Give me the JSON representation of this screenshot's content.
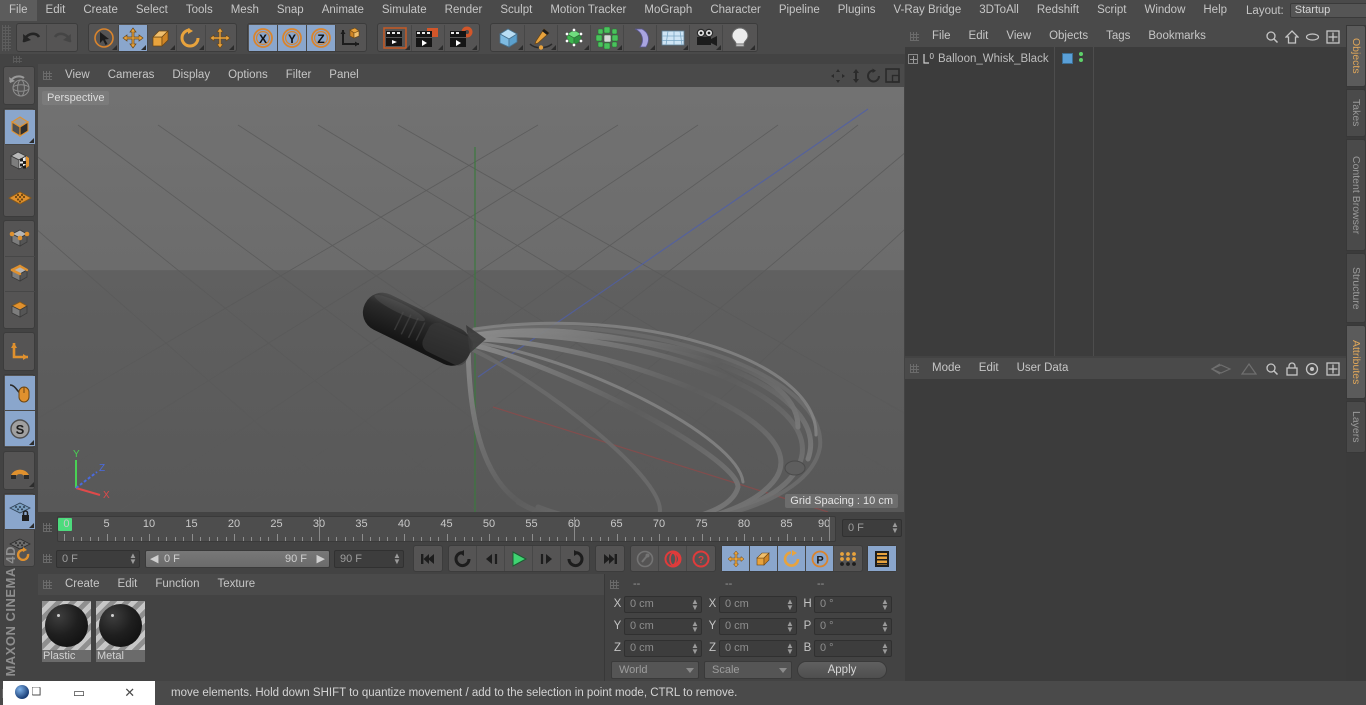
{
  "menubar": {
    "items": [
      "File",
      "Edit",
      "Create",
      "Select",
      "Tools",
      "Mesh",
      "Snap",
      "Animate",
      "Simulate",
      "Render",
      "Sculpt",
      "Motion Tracker",
      "MoGraph",
      "Character",
      "Pipeline",
      "Plugins",
      "V-Ray Bridge",
      "3DToAll",
      "Redshift",
      "Script",
      "Window",
      "Help"
    ],
    "layout_label": "Layout:",
    "layout_value": "Startup",
    "search_icon": "search-icon"
  },
  "toolbar": {
    "groups": [
      {
        "name": "undo-redo",
        "buttons": [
          {
            "icon": "undo-icon",
            "active": false
          },
          {
            "icon": "redo-icon",
            "active": false
          }
        ]
      },
      {
        "name": "transform-tools",
        "buttons": [
          {
            "icon": "live-selection-icon",
            "active": false
          },
          {
            "icon": "move-icon",
            "active": true
          },
          {
            "icon": "scale-icon",
            "active": false
          },
          {
            "icon": "rotate-icon",
            "active": false
          },
          {
            "icon": "move-dynamic-icon",
            "active": false
          }
        ]
      },
      {
        "name": "axis-locks",
        "buttons": [
          {
            "icon": "x-axis-icon",
            "active": true
          },
          {
            "icon": "y-axis-icon",
            "active": true
          },
          {
            "icon": "z-axis-icon",
            "active": true
          },
          {
            "icon": "world-object-axis-icon",
            "active": false
          }
        ]
      },
      {
        "name": "render-tools",
        "buttons": [
          {
            "icon": "render-view-icon",
            "active": false
          },
          {
            "icon": "render-region-icon",
            "active": false
          },
          {
            "icon": "render-settings-icon",
            "active": false
          }
        ]
      },
      {
        "name": "create-objects",
        "buttons": [
          {
            "icon": "cube-primitive-icon",
            "active": false
          },
          {
            "icon": "spline-pen-icon",
            "active": false
          },
          {
            "icon": "nurbs-generator-icon",
            "active": false
          },
          {
            "icon": "array-modeling-icon",
            "active": false
          },
          {
            "icon": "deformer-bend-icon",
            "active": false
          },
          {
            "icon": "floor-environment-icon",
            "active": false
          },
          {
            "icon": "camera-icon",
            "active": false
          },
          {
            "icon": "light-icon",
            "active": false
          }
        ]
      }
    ]
  },
  "left_toolbar": {
    "groups": [
      {
        "buttons": [
          {
            "icon": "undo-view-globe-icon",
            "active": false
          }
        ]
      },
      {
        "buttons": [
          {
            "icon": "model-mode-icon",
            "active": true
          },
          {
            "icon": "texture-mode-icon",
            "active": false
          },
          {
            "icon": "workplane-mode-icon",
            "active": false
          }
        ]
      },
      {
        "buttons": [
          {
            "icon": "point-mode-icon",
            "active": false
          },
          {
            "icon": "edge-mode-icon",
            "active": false
          },
          {
            "icon": "polygon-mode-icon",
            "active": false
          }
        ]
      },
      {
        "buttons": [
          {
            "icon": "axis-modify-icon",
            "active": false
          }
        ]
      },
      {
        "buttons": [
          {
            "icon": "enable-axis-mouse-icon",
            "active": true
          },
          {
            "icon": "snap-mode-icon",
            "active": true
          }
        ]
      },
      {
        "buttons": [
          {
            "icon": "magnet-tool-icon",
            "active": false
          }
        ]
      },
      {
        "buttons": [
          {
            "icon": "workplane-lock-icon",
            "active": true
          },
          {
            "icon": "workplane-rotate-icon",
            "active": false
          }
        ]
      }
    ],
    "brand": "MAXON CINEMA 4D"
  },
  "viewport": {
    "menu": [
      "View",
      "Cameras",
      "Display",
      "Options",
      "Filter",
      "Panel"
    ],
    "icons": [
      "pan-view-icon",
      "dolly-view-icon",
      "rotate-view-icon",
      "maximize-view-icon"
    ],
    "label": "Perspective",
    "grid_spacing": "Grid Spacing : 10 cm",
    "axis": {
      "x": "X",
      "y": "Y",
      "z": "Z",
      "x_color": "#e04a4a",
      "y_color": "#49d154",
      "z_color": "#4a6ae0"
    },
    "object": "Balloon_Whisk_Black 3D model"
  },
  "timeline": {
    "ruler_min": 0,
    "ruler_max": 90,
    "tick_labels": [
      0,
      5,
      10,
      15,
      20,
      25,
      30,
      35,
      40,
      45,
      50,
      55,
      60,
      65,
      70,
      75,
      80,
      85,
      90
    ],
    "current_frame_field": "0 F",
    "start_frame_field": "0 F",
    "range_start": "0 F",
    "range_end": "90 F",
    "end_frame_field": "90 F",
    "playback_buttons": [
      {
        "icon": "go-to-start-icon",
        "active": false
      },
      {
        "icon": "play-backward-loop-icon",
        "active": false
      },
      {
        "icon": "step-back-icon",
        "active": false
      },
      {
        "icon": "play-forward-icon",
        "active": false
      },
      {
        "icon": "step-forward-icon",
        "active": false
      },
      {
        "icon": "loop-playback-icon",
        "active": false
      },
      {
        "icon": "go-to-end-icon",
        "active": false
      }
    ],
    "key_buttons": [
      {
        "icon": "record-key-icon",
        "active": false
      },
      {
        "icon": "autokey-icon",
        "active": false
      },
      {
        "icon": "keyframe-selection-icon",
        "active": false
      }
    ],
    "param_buttons": [
      {
        "icon": "key-position-icon",
        "active": true
      },
      {
        "icon": "key-scale-icon",
        "active": true
      },
      {
        "icon": "key-rotation-icon",
        "active": true
      },
      {
        "icon": "key-param-icon",
        "active": true
      },
      {
        "icon": "point-level-animation-icon",
        "active": false
      },
      {
        "icon": "timeline-ruler-icon",
        "active": true
      }
    ]
  },
  "material_manager": {
    "menu": [
      "Create",
      "Edit",
      "Function",
      "Texture"
    ],
    "materials": [
      {
        "name": "Plastic",
        "selected": true
      },
      {
        "name": "Metal",
        "selected": true
      }
    ]
  },
  "coordinates": {
    "headers": [
      "--",
      "--",
      "--"
    ],
    "rows": [
      {
        "label1": "X",
        "value1": "0 cm",
        "label2": "X",
        "value2": "0 cm",
        "label3": "H",
        "value3": "0 °"
      },
      {
        "label1": "Y",
        "value1": "0 cm",
        "label2": "Y",
        "value2": "0 cm",
        "label3": "P",
        "value3": "0 °"
      },
      {
        "label1": "Z",
        "value1": "0 cm",
        "label2": "Z",
        "value2": "0 cm",
        "label3": "B",
        "value3": "0 °"
      }
    ],
    "system_select": "World",
    "mode_select": "Scale",
    "apply_label": "Apply"
  },
  "object_manager": {
    "menu": [
      "File",
      "Edit",
      "View",
      "Objects",
      "Tags",
      "Bookmarks"
    ],
    "icons": [
      "search-icon",
      "home-icon",
      "ellipse-icon",
      "plus-box-icon"
    ],
    "objects": [
      {
        "name": "Balloon_Whisk_Black",
        "expandable": true,
        "icon": "null-object-icon",
        "tag_color": "#5aa0d8"
      }
    ]
  },
  "attributes": {
    "menu": [
      "Mode",
      "Edit",
      "User Data"
    ],
    "icons": [
      "layers-back-icon",
      "layers-forward-icon",
      "search-icon",
      "lock-icon",
      "target-icon",
      "plus-box-icon"
    ]
  },
  "side_tabs": [
    {
      "label": "Objects",
      "active": true
    },
    {
      "label": "Takes",
      "active": false
    },
    {
      "label": "Content Browser",
      "active": false
    },
    {
      "label": "Structure",
      "active": false
    },
    {
      "label": "Attributes",
      "active": true
    },
    {
      "label": "Layers",
      "active": false
    }
  ],
  "status": {
    "message": "move elements. Hold down SHIFT to quantize movement / add to the selection in point mode, CTRL to remove."
  },
  "taskbar": {
    "items": [
      "windows-logo-icon",
      "restore-window-icon",
      "minimize-icon",
      "close-icon"
    ]
  }
}
